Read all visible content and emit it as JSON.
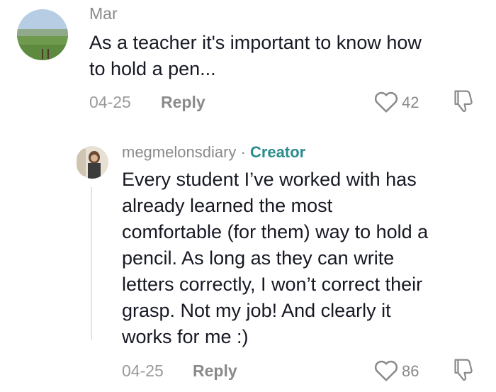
{
  "comment": {
    "username": "Mar",
    "text_lines": [
      "As a teacher it's important to know how",
      "to hold a pen..."
    ],
    "date": "04-25",
    "reply_label": "Reply",
    "like_count": "42",
    "avatar_icon": "landscape-avatar"
  },
  "reply": {
    "username": "megmelonsdiary",
    "separator": "·",
    "badge": "Creator",
    "text_lines": [
      "Every student I’ve worked with has",
      "already learned the most",
      "comfortable (for them) way to hold a",
      "pencil. As long as they can write",
      "letters correctly, I won’t correct their",
      "grasp. Not my job! And clearly it",
      "works for me :)"
    ],
    "date": "04-25",
    "reply_label": "Reply",
    "like_count": "86",
    "avatar_icon": "person-avatar"
  },
  "icons": {
    "like": "heart-icon",
    "dislike": "thumbs-down-icon"
  },
  "colors": {
    "creator": "#2a8c8c",
    "text": "#161823",
    "muted": "#8a8a8a"
  }
}
